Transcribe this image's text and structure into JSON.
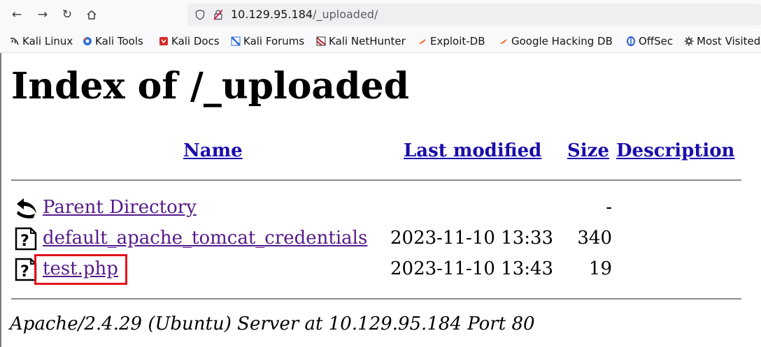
{
  "browser": {
    "url_host": "10.129.95.184",
    "url_path": "/_uploaded/",
    "bookmarks": [
      {
        "label": "Kali Linux",
        "icon": "kali-dragon-icon",
        "color": "#1f1f1f"
      },
      {
        "label": "Kali Tools",
        "icon": "kali-tools-icon",
        "color": "#2b6fd6"
      },
      {
        "label": "Kali Docs",
        "icon": "kali-docs-icon",
        "color": "#d62b2b"
      },
      {
        "label": "Kali Forums",
        "icon": "kali-forums-icon",
        "color": "#2b6fd6"
      },
      {
        "label": "Kali NetHunter",
        "icon": "kali-nethunter-icon",
        "color": "#c0262c"
      },
      {
        "label": "Exploit-DB",
        "icon": "exploit-db-icon",
        "color": "#f26522"
      },
      {
        "label": "Google Hacking DB",
        "icon": "ghdb-icon",
        "color": "#f26522"
      },
      {
        "label": "OffSec",
        "icon": "offsec-icon",
        "color": "#2b5fd6"
      },
      {
        "label": "Most Visited",
        "icon": "gear-icon",
        "color": "#3a3a3f"
      }
    ]
  },
  "page": {
    "title": "Index of /_uploaded",
    "columns": {
      "name": "Name",
      "last_modified": "Last modified",
      "size": "Size",
      "description": "Description"
    },
    "rows": [
      {
        "name": "Parent Directory",
        "date": "",
        "size": "-",
        "icon": "back-arrow-icon"
      },
      {
        "name": "default_apache_tomcat_credentials",
        "date": "2023-11-10 13:33",
        "size": "340",
        "icon": "unknown-file-icon"
      },
      {
        "name": "test.php",
        "date": "2023-11-10 13:43",
        "size": "19",
        "icon": "unknown-file-icon"
      }
    ],
    "footer": "Apache/2.4.29 (Ubuntu) Server at 10.129.95.184 Port 80"
  },
  "colors": {
    "link": "#1a0dab",
    "visited_link": "#551a8b",
    "highlight": "#e3131b"
  }
}
